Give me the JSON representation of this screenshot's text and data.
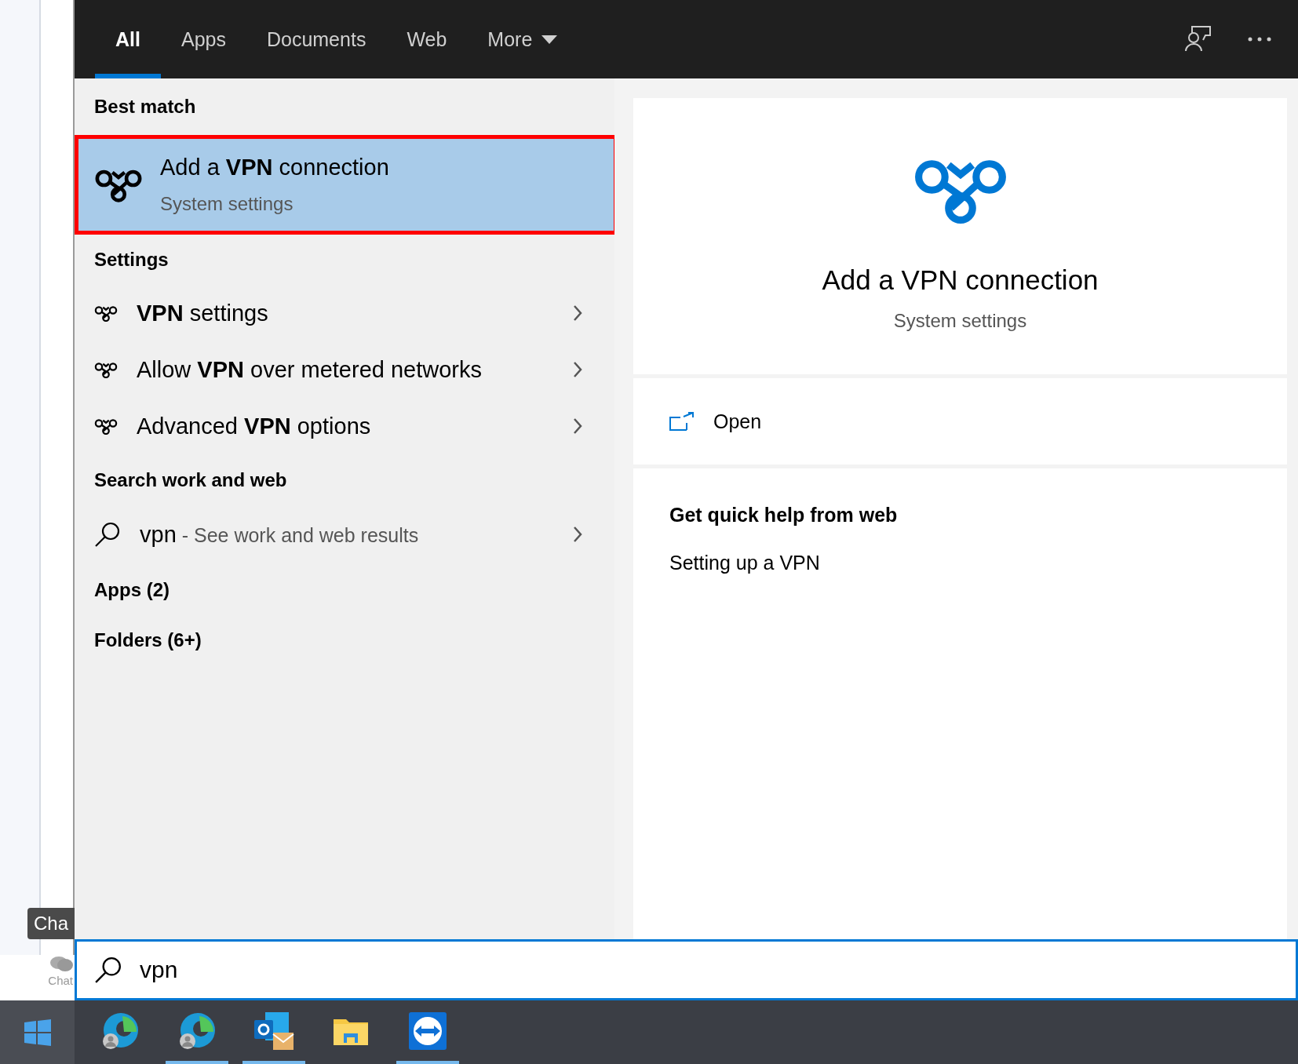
{
  "backdrop": {
    "tooltip": "Cha",
    "chat_label": "Chat"
  },
  "tabs": [
    {
      "label": "All",
      "selected": true,
      "kind": "tab"
    },
    {
      "label": "Apps",
      "selected": false,
      "kind": "tab"
    },
    {
      "label": "Documents",
      "selected": false,
      "kind": "tab"
    },
    {
      "label": "Web",
      "selected": false,
      "kind": "tab"
    },
    {
      "label": "More",
      "selected": false,
      "kind": "menu"
    }
  ],
  "best_match": {
    "heading": "Best match",
    "title": "Add a **VPN** connection",
    "subtitle": "System settings",
    "selected": true,
    "outlined": true
  },
  "sections": [
    {
      "heading": "Settings",
      "items": [
        {
          "kind": "setting",
          "label": "**VPN** settings"
        },
        {
          "kind": "setting",
          "label": "Allow **VPN** over metered networks"
        },
        {
          "kind": "setting",
          "label": "Advanced **VPN** options"
        }
      ]
    },
    {
      "heading": "Search work and web",
      "items": [
        {
          "kind": "web",
          "label": "vpn",
          "hint": " - See work and web results"
        }
      ]
    }
  ],
  "groups": [
    "Apps (2)",
    "Folders (6+)"
  ],
  "preview": {
    "title": "Add a VPN connection",
    "subtitle": "System settings",
    "actions": [
      "Open"
    ],
    "help_heading": "Get quick help from web",
    "help_links": [
      "Setting up a VPN"
    ]
  },
  "search": {
    "value": "vpn"
  },
  "taskbar": [
    {
      "kind": "edge",
      "running": false
    },
    {
      "kind": "edge",
      "running": true
    },
    {
      "kind": "outlook",
      "running": true
    },
    {
      "kind": "folder",
      "running": false
    },
    {
      "kind": "remote",
      "running": true
    }
  ]
}
